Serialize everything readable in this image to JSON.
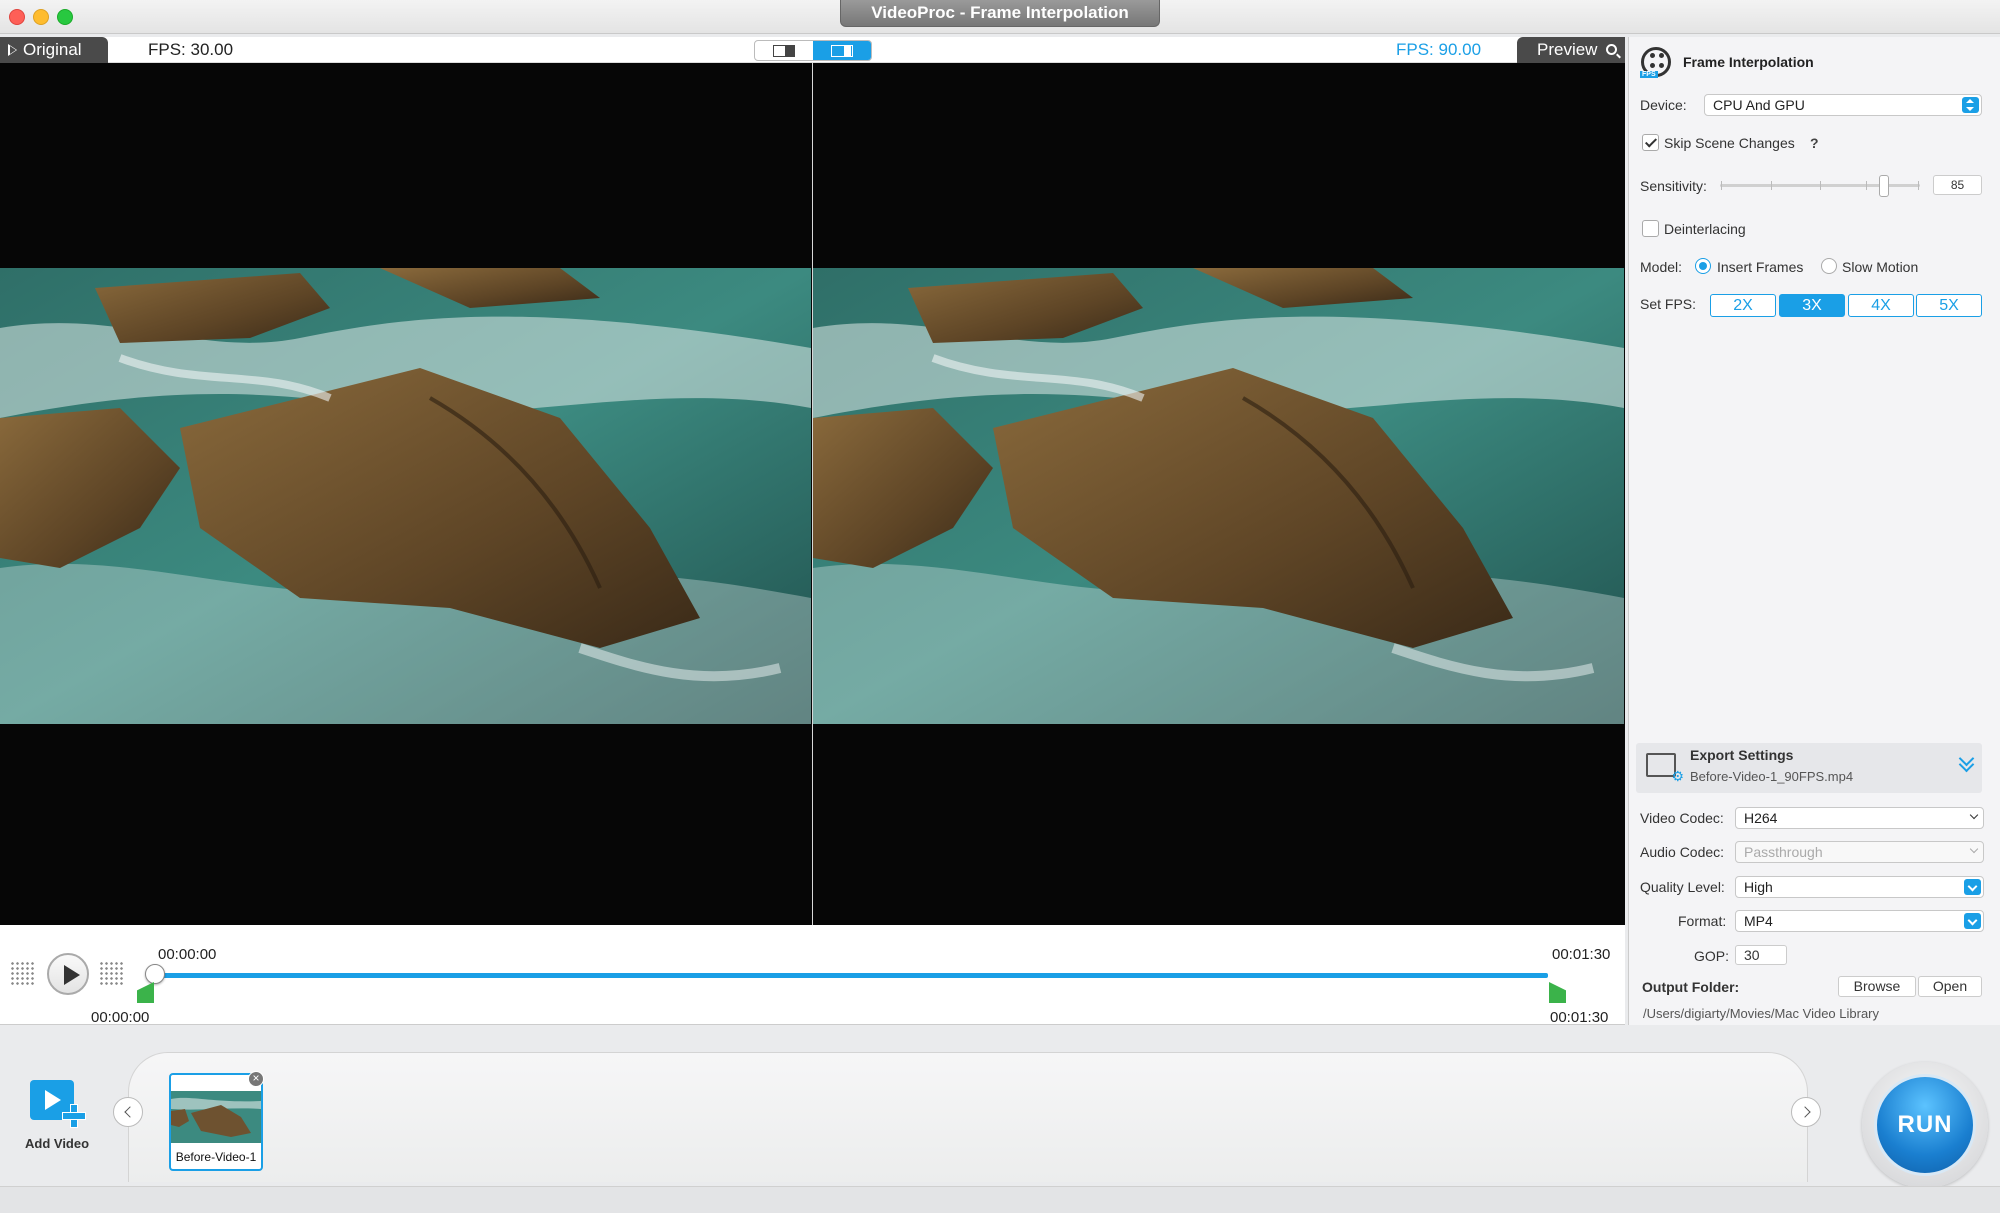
{
  "window": {
    "title": "VideoProc - Frame Interpolation"
  },
  "preview": {
    "original_tab": "Original",
    "fps_original": "FPS: 30.00",
    "fps_preview": "FPS: 90.00",
    "preview_tab": "Preview"
  },
  "timeline": {
    "current_time": "00:00:00",
    "end_time_top": "00:01:30",
    "start_marker_time": "00:00:00",
    "end_marker_time": "00:01:30"
  },
  "settings": {
    "title": "Frame Interpolation",
    "device_label": "Device:",
    "device_value": "CPU And GPU",
    "skip_scene_label": "Skip Scene Changes",
    "skip_scene_checked": true,
    "help_mark": "?",
    "sensitivity_label": "Sensitivity:",
    "sensitivity_value": "85",
    "deinterlacing_label": "Deinterlacing",
    "deinterlacing_checked": false,
    "model_label": "Model:",
    "model_options": [
      "Insert Frames",
      "Slow Motion"
    ],
    "model_selected": "Insert Frames",
    "set_fps_label": "Set FPS:",
    "fps_options": [
      "2X",
      "3X",
      "4X",
      "5X"
    ],
    "fps_selected": "3X"
  },
  "export": {
    "title": "Export Settings",
    "filename": "Before-Video-1_90FPS.mp4",
    "video_codec_label": "Video Codec:",
    "video_codec": "H264",
    "audio_codec_label": "Audio Codec:",
    "audio_codec": "Passthrough",
    "quality_label": "Quality Level:",
    "quality": "High",
    "format_label": "Format:",
    "format": "MP4",
    "gop_label": "GOP:",
    "gop": "30",
    "output_folder_label": "Output Folder:",
    "browse": "Browse",
    "open": "Open",
    "output_path": "/Users/digiarty/Movies/Mac Video Library"
  },
  "bottom": {
    "add_video": "Add Video",
    "clip_name": "Before-Video-1",
    "run": "RUN"
  },
  "colors": {
    "accent": "#1a9fe6",
    "marker_green": "#3bb34a"
  }
}
